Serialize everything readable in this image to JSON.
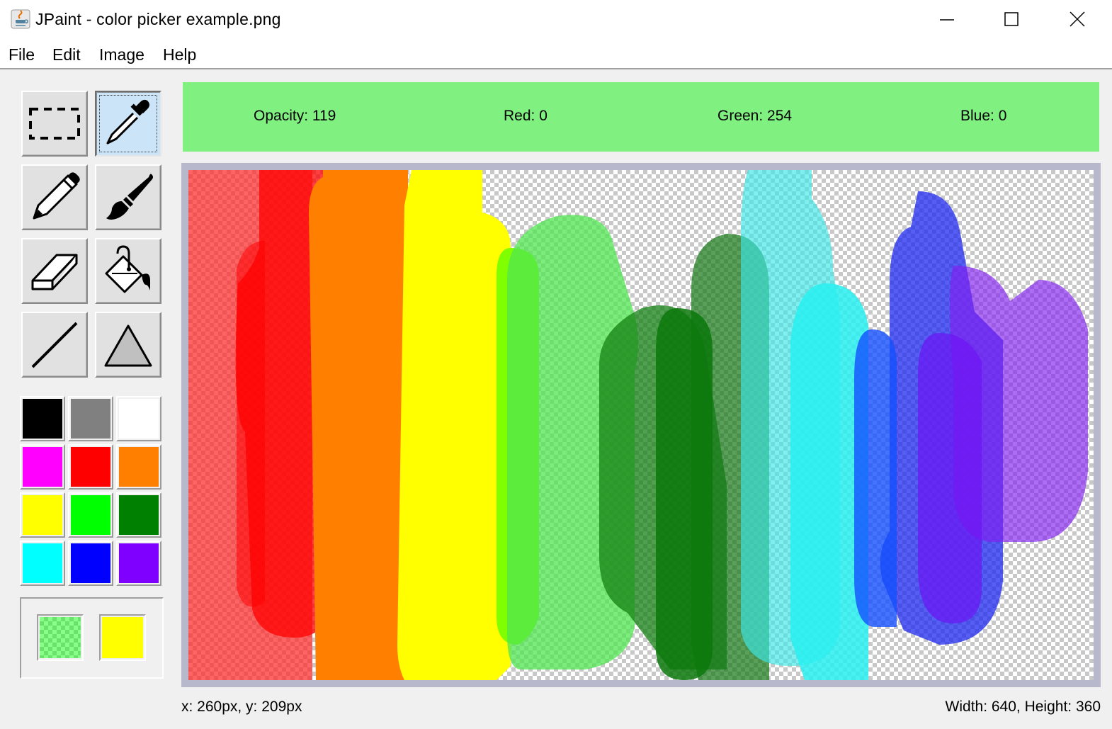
{
  "window": {
    "title": "JPaint - color picker example.png"
  },
  "menu": {
    "items": [
      {
        "label": "File"
      },
      {
        "label": "Edit"
      },
      {
        "label": "Image"
      },
      {
        "label": "Help"
      }
    ]
  },
  "tools": [
    {
      "name": "selection",
      "icon": "dashed-rectangle-icon",
      "selected": false
    },
    {
      "name": "color-picker",
      "icon": "eyedropper-icon",
      "selected": true
    },
    {
      "name": "pencil",
      "icon": "pencil-icon",
      "selected": false
    },
    {
      "name": "brush",
      "icon": "paintbrush-icon",
      "selected": false
    },
    {
      "name": "eraser",
      "icon": "eraser-icon",
      "selected": false
    },
    {
      "name": "fill",
      "icon": "paint-bucket-icon",
      "selected": false
    },
    {
      "name": "line",
      "icon": "line-icon",
      "selected": false
    },
    {
      "name": "shape",
      "icon": "triangle-icon",
      "selected": false
    }
  ],
  "palette": {
    "colors": [
      "#000000",
      "#808080",
      "#ffffff",
      "#ff00ff",
      "#ff0000",
      "#ff8000",
      "#ffff00",
      "#00ff00",
      "#008000",
      "#00ffff",
      "#0000ff",
      "#8000ff"
    ]
  },
  "current_colors": {
    "primary": "#00fe00",
    "primary_opacity": 119,
    "secondary": "#ffff00"
  },
  "picked_color": {
    "opacity_label": "Opacity: 119",
    "red_label": "Red: 0",
    "green_label": "Green: 254",
    "blue_label": "Blue: 0",
    "swatch": "#80f080"
  },
  "status": {
    "cursor_position": "x: 260px, y: 209px",
    "image_size": "Width: 640, Height: 360"
  }
}
